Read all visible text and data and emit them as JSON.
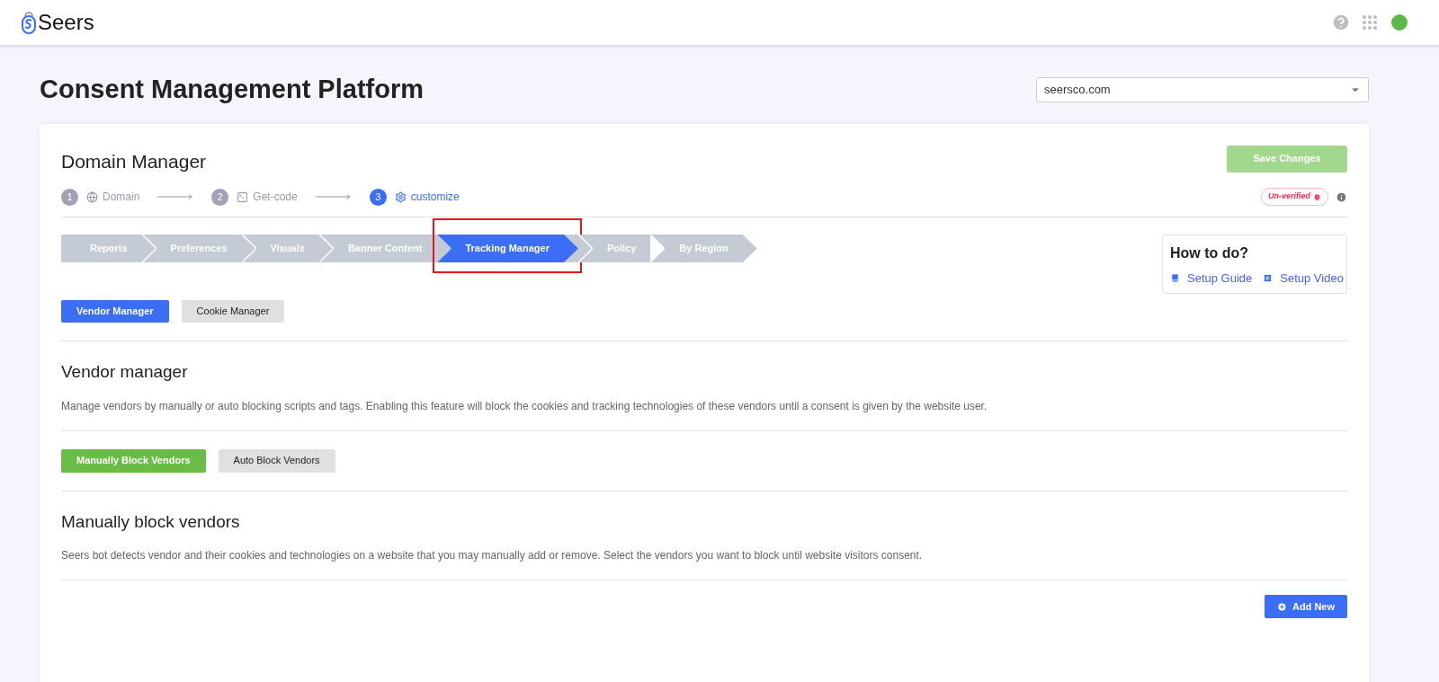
{
  "header": {
    "logo": "Seers"
  },
  "page": {
    "title": "Consent Management Platform",
    "domain_select": {
      "value": "seersco.com"
    }
  },
  "card": {
    "title": "Domain Manager",
    "save_button": "Save Changes",
    "steps": [
      {
        "number": "1",
        "label": "Domain",
        "selected": false
      },
      {
        "number": "2",
        "label": "Get-code",
        "selected": false
      },
      {
        "number": "3",
        "label": "customize",
        "selected": true
      }
    ],
    "status_badge": "Un-verified",
    "tabs": [
      {
        "label": "Reports",
        "selected": false,
        "highlighted": false
      },
      {
        "label": "Preferences",
        "selected": false,
        "highlighted": false
      },
      {
        "label": "Visuals",
        "selected": false,
        "highlighted": false
      },
      {
        "label": "Banner Content",
        "selected": false,
        "highlighted": false
      },
      {
        "label": "Tracking Manager",
        "selected": true,
        "highlighted": true
      },
      {
        "label": "Policy",
        "selected": false,
        "highlighted": false
      },
      {
        "label": "By Region",
        "selected": false,
        "highlighted": false
      }
    ],
    "help": {
      "title": "How to do?",
      "links": [
        {
          "label": "Setup Guide"
        },
        {
          "label": "Setup Video"
        }
      ]
    },
    "subtabs": [
      {
        "label": "Vendor Manager",
        "selected": true
      },
      {
        "label": "Cookie Manager",
        "selected": false
      }
    ],
    "vendor_section": {
      "title": "Vendor manager",
      "description": "Manage vendors by manually or auto blocking scripts and tags. Enabling this feature will block the cookies and tracking technologies of these vendors until a consent is given by the website user."
    },
    "block_modes": [
      {
        "label": "Manually Block Vendors",
        "selected": true
      },
      {
        "label": "Auto Block Vendors",
        "selected": false
      }
    ],
    "manual_section": {
      "title": "Manually block vendors",
      "description": "Seers bot detects vendor and their cookies and technologies on a website that you may manually add or remove. Select the vendors you want to block until website visitors consent."
    },
    "add_button": "Add New"
  }
}
